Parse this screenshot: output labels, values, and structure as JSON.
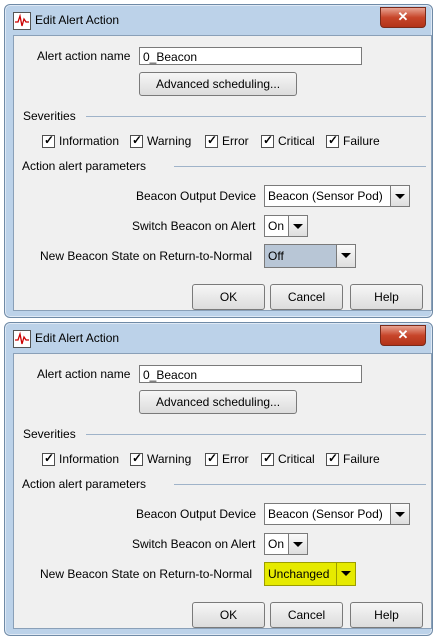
{
  "dialogs": [
    {
      "title": "Edit Alert Action",
      "close_label": "✕",
      "alert_action_name_label": "Alert action name",
      "alert_action_name_value": "0_Beacon",
      "advanced_scheduling_label": "Advanced scheduling...",
      "severities_title": "Severities",
      "severities": [
        {
          "label": "Information",
          "checked": true
        },
        {
          "label": "Warning",
          "checked": true
        },
        {
          "label": "Error",
          "checked": true
        },
        {
          "label": "Critical",
          "checked": true
        },
        {
          "label": "Failure",
          "checked": true
        }
      ],
      "params_title": "Action alert parameters",
      "beacon_output_device_label": "Beacon Output Device",
      "beacon_output_device_value": "Beacon (Sensor Pod)",
      "switch_beacon_label": "Switch Beacon on Alert",
      "switch_beacon_value": "On",
      "return_state_label": "New Beacon State on Return-to-Normal",
      "return_state_value": "Off",
      "ok_label": "OK",
      "cancel_label": "Cancel",
      "help_label": "Help"
    },
    {
      "title": "Edit Alert Action",
      "close_label": "✕",
      "alert_action_name_label": "Alert action name",
      "alert_action_name_value": "0_Beacon",
      "advanced_scheduling_label": "Advanced scheduling...",
      "severities_title": "Severities",
      "severities": [
        {
          "label": "Information",
          "checked": true
        },
        {
          "label": "Warning",
          "checked": true
        },
        {
          "label": "Error",
          "checked": true
        },
        {
          "label": "Critical",
          "checked": true
        },
        {
          "label": "Failure",
          "checked": true
        }
      ],
      "params_title": "Action alert parameters",
      "beacon_output_device_label": "Beacon Output Device",
      "beacon_output_device_value": "Beacon (Sensor Pod)",
      "switch_beacon_label": "Switch Beacon on Alert",
      "switch_beacon_value": "On",
      "return_state_label": "New Beacon State on Return-to-Normal",
      "return_state_value": "Unchanged",
      "ok_label": "OK",
      "cancel_label": "Cancel",
      "help_label": "Help"
    }
  ],
  "colors": {
    "highlight": "#e6ea00",
    "close_button": "#c7452a",
    "frame": "#bcd2e9"
  }
}
